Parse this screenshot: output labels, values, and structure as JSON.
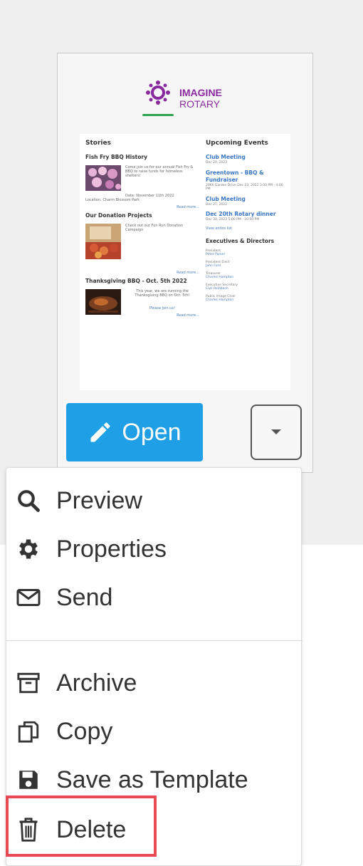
{
  "open_button": {
    "label": "Open",
    "icon": "pencil-icon"
  },
  "dropdown_button": {
    "icon": "caret-down-icon"
  },
  "logo": {
    "line1": "IMAGINE",
    "line2": "ROTARY"
  },
  "newsletter": {
    "stories_heading": "Stories",
    "stories": [
      {
        "title": "Fish Fry BBQ History",
        "text": "Come join us for our annual Fish Fry & BBQ to raise funds for homeless shelters!",
        "meta1": "Date: November 11th 2022",
        "meta2": "Location: Charm Blossom Park",
        "readmore": "Read more..."
      },
      {
        "title": "Our Donation Projects",
        "text": "Check out our Fun Run Donation Campaign",
        "readmore": "Read more..."
      },
      {
        "title": "Thanksgiving BBQ - Oct. 5th 2022",
        "text": "This year, we are running the Thanksgiving BBQ on Oct. 5th!",
        "link": "Please join us!",
        "readmore": "Read more..."
      }
    ],
    "events_heading": "Upcoming Events",
    "events": [
      {
        "title": "Club Meeting",
        "meta": "Dec 20, 2022"
      },
      {
        "title": "Greentown - BBQ & Fundraiser",
        "meta": "2060 Garden Drive Dec 23, 2022 3:00 PM - 4:00 PM"
      },
      {
        "title": "Club Meeting",
        "meta": "Dec 27, 2022"
      },
      {
        "title": "Dec 20th Rotary dinner",
        "meta": "Dec 30, 2022 5:00 PM - 10:00 PM"
      }
    ],
    "view_link": "View entire list",
    "directors_heading": "Executives & Directors",
    "directors": [
      {
        "role": "President",
        "name": "Peter Parker"
      },
      {
        "role": "President Elect",
        "name": "John Ford"
      },
      {
        "role": "Treasurer",
        "name": "Charles Hampton"
      },
      {
        "role": "Executive Secretary",
        "name": "Civil Reinbach"
      },
      {
        "role": "Public Image Chair",
        "name": "Charles Hampton"
      }
    ]
  },
  "menu": {
    "items": [
      {
        "label": "Preview",
        "icon": "search-icon"
      },
      {
        "label": "Properties",
        "icon": "gear-icon"
      },
      {
        "label": "Send",
        "icon": "envelope-icon"
      },
      {
        "label": "Archive",
        "icon": "archive-icon"
      },
      {
        "label": "Copy",
        "icon": "copy-icon"
      },
      {
        "label": "Save as Template",
        "icon": "floppy-disk-icon"
      },
      {
        "label": "Delete",
        "icon": "trash-icon"
      }
    ]
  },
  "colors": {
    "open_button": "#1e9fe6",
    "highlight": "#e84a53",
    "logo_purple": "#8a2a9e",
    "link_blue": "#3a78c3"
  }
}
